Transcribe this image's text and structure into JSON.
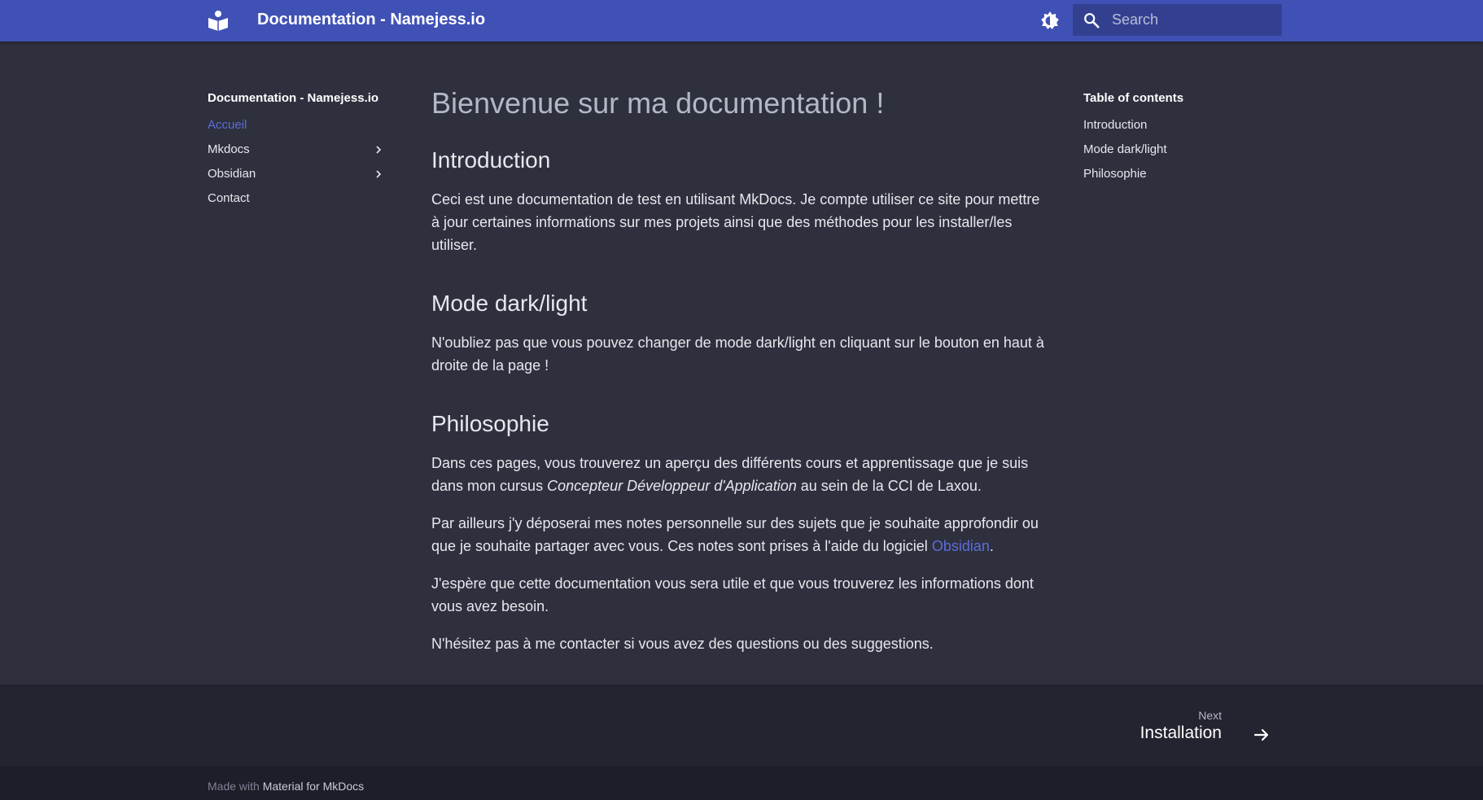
{
  "header": {
    "title": "Documentation - Namejess.io",
    "search_placeholder": "Search"
  },
  "sidebar": {
    "title": "Documentation - Namejess.io",
    "items": [
      {
        "label": "Accueil",
        "active": true
      },
      {
        "label": "Mkdocs",
        "expandable": true
      },
      {
        "label": "Obsidian",
        "expandable": true
      },
      {
        "label": "Contact"
      }
    ]
  },
  "content": {
    "title": "Bienvenue sur ma documentation !",
    "sections": [
      {
        "heading": "Introduction",
        "paragraphs": [
          "Ceci est une documentation de test en utilisant MkDocs. Je compte utiliser ce site pour mettre à jour certaines informations sur mes projets ainsi que des méthodes pour les installer/les utiliser."
        ]
      },
      {
        "heading": "Mode dark/light",
        "paragraphs": [
          "N'oubliez pas que vous pouvez changer de mode dark/light en cliquant sur le bouton en haut à droite de la page !"
        ]
      },
      {
        "heading": "Philosophie",
        "p1_before": "Dans ces pages, vous trouverez un aperçu des différents cours et apprentissage que je suis dans mon cursus ",
        "p1_em": "Concepteur Développeur d'Application",
        "p1_after": " au sein de la CCI de Laxou.",
        "p2_before": "Par ailleurs j'y déposerai mes notes personnelle sur des sujets que je souhaite approfondir ou que je souhaite partager avec vous. Ces notes sont prises à l'aide du logiciel ",
        "p2_link": "Obsidian",
        "p2_after": ".",
        "p3": "J'espère que cette documentation vous sera utile et que vous trouverez les informations dont vous avez besoin.",
        "p4": "N'hésitez pas à me contacter si vous avez des questions ou des suggestions."
      }
    ]
  },
  "toc": {
    "title": "Table of contents",
    "items": [
      "Introduction",
      "Mode dark/light",
      "Philosophie"
    ]
  },
  "footer": {
    "next_label": "Next",
    "next_title": "Installation",
    "made_with": "Made with",
    "made_with_link": "Material for MkDocs"
  },
  "colors": {
    "header_bg": "#4051b5",
    "page_bg": "#2e303e",
    "accent": "#5b6dd9",
    "footer_bg": "#23242f",
    "footer_meta_bg": "#1d1e27"
  }
}
